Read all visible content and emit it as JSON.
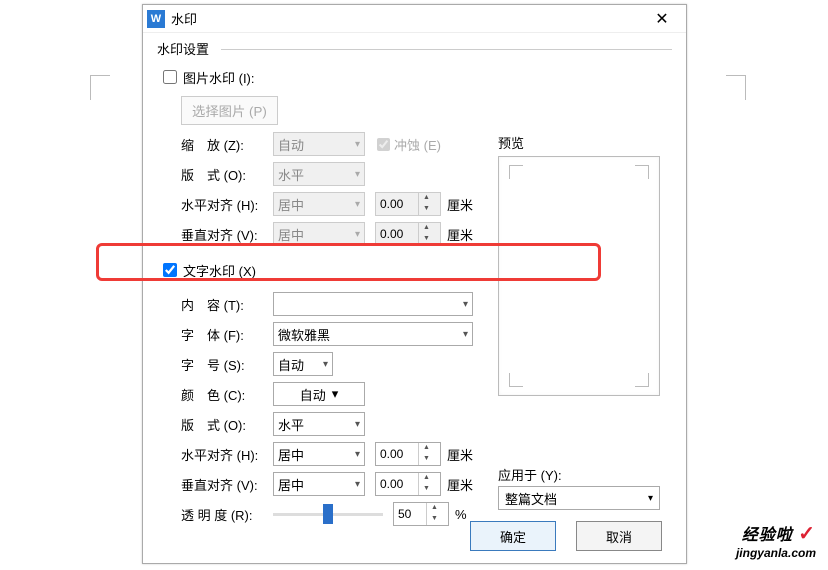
{
  "window": {
    "title": "水印",
    "icon_letter": "W"
  },
  "fieldset": {
    "title": "水印设置"
  },
  "image_wm": {
    "checkbox_label": "图片水印 (I):",
    "select_btn": "选择图片 (P)",
    "scale_label": "缩　放 (Z):",
    "scale_value": "自动",
    "erosion_label": "冲蚀 (E)",
    "layout_label": "版　式 (O):",
    "layout_value": "水平",
    "halign_label": "水平对齐 (H):",
    "halign_value": "居中",
    "halign_num": "0.00",
    "halign_unit": "厘米",
    "valign_label": "垂直对齐 (V):",
    "valign_value": "居中",
    "valign_num": "0.00",
    "valign_unit": "厘米"
  },
  "text_wm": {
    "checkbox_label": "文字水印 (X)",
    "content_label": "内　容 (T):",
    "content_value": "",
    "font_label": "字　体 (F):",
    "font_value": "微软雅黑",
    "size_label": "字　号 (S):",
    "size_value": "自动",
    "color_label": "颜　色 (C):",
    "color_value": "自动",
    "layout_label": "版　式 (O):",
    "layout_value": "水平",
    "halign_label": "水平对齐 (H):",
    "halign_value": "居中",
    "halign_num": "0.00",
    "halign_unit": "厘米",
    "valign_label": "垂直对齐 (V):",
    "valign_value": "居中",
    "valign_num": "0.00",
    "valign_unit": "厘米",
    "opacity_label": "透 明 度 (R):",
    "opacity_value": "50",
    "opacity_unit": "%"
  },
  "preview": {
    "label": "预览"
  },
  "apply": {
    "label": "应用于 (Y):",
    "value": "整篇文档"
  },
  "footer": {
    "ok": "确定",
    "cancel": "取消"
  },
  "logo": {
    "line1": "经验啦",
    "line2": "jingyanla.com"
  }
}
